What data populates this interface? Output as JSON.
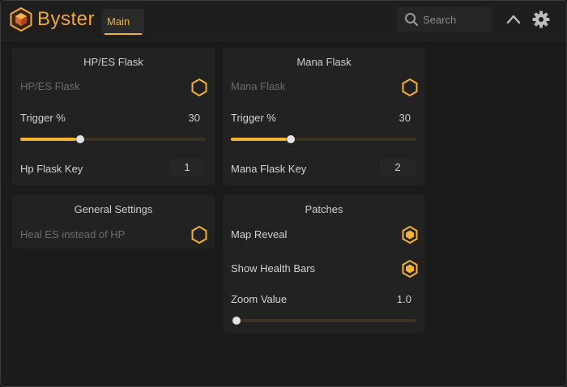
{
  "app": {
    "brand": "Byster",
    "accent": "#f2b233"
  },
  "tabs": [
    {
      "label": "Main",
      "active": true
    }
  ],
  "search": {
    "placeholder": "Search"
  },
  "icons": {
    "collapse": "chevron-up-icon",
    "settings": "gear-icon",
    "search": "search-icon",
    "logo": "hexagon-logo-icon"
  },
  "panels": {
    "hp_es_flask": {
      "title": "HP/ES Flask",
      "toggle_label": "HP/ES Flask",
      "toggle_enabled": false,
      "trigger_label": "Trigger %",
      "trigger_value": "30",
      "trigger_fraction": 0.3,
      "key_label": "Hp Flask Key",
      "key_value": "1"
    },
    "mana_flask": {
      "title": "Mana Flask",
      "toggle_label": "Mana Flask",
      "toggle_enabled": false,
      "trigger_label": "Trigger %",
      "trigger_value": "30",
      "trigger_fraction": 0.3,
      "key_label": "Mana Flask Key",
      "key_value": "2"
    },
    "general_settings": {
      "title": "General Settings",
      "toggle_label": "Heal ES instead of HP",
      "toggle_enabled": false
    },
    "patches": {
      "title": "Patches",
      "map_reveal_label": "Map Reveal",
      "map_reveal_enabled": true,
      "health_bars_label": "Show Health Bars",
      "health_bars_enabled": true,
      "zoom_label": "Zoom Value",
      "zoom_value": "1.0",
      "zoom_fraction": 0.0
    }
  }
}
